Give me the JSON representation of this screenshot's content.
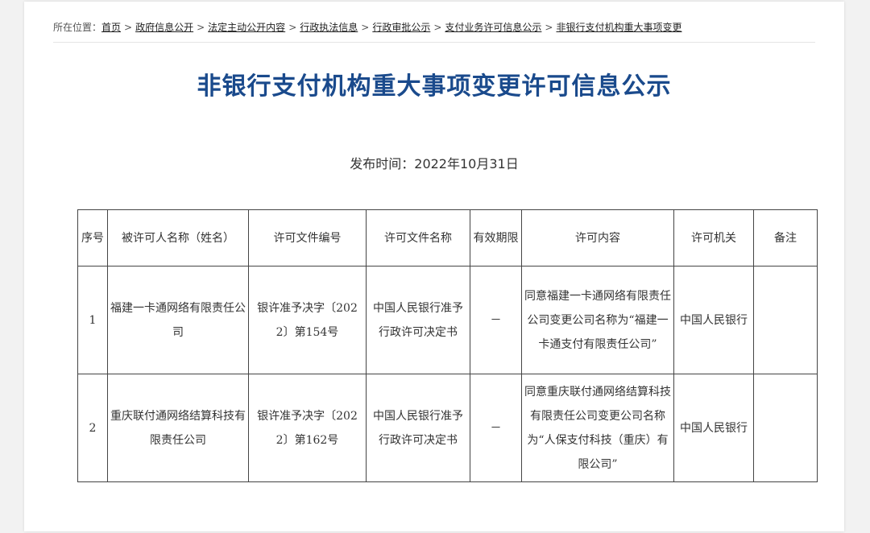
{
  "breadcrumb": {
    "prefix": "所在位置：",
    "items": [
      "首页",
      "政府信息公开",
      "法定主动公开内容",
      "行政执法信息",
      "行政审批公示",
      "支付业务许可信息公示",
      "非银行支付机构重大事项变更"
    ],
    "separator": ">"
  },
  "title": "非银行支付机构重大事项变更许可信息公示",
  "publish_date": "发布时间：2022年10月31日",
  "table": {
    "headers": [
      "序号",
      "被许可人名称（姓名）",
      "许可文件编号",
      "许可文件名称",
      "有效期限",
      "许可内容",
      "许可机关",
      "备注"
    ],
    "rows": [
      [
        "1",
        "福建一卡通网络有限责任公司",
        "银许准予决字〔2022〕第154号",
        "中国人民银行准予行政许可决定书",
        "－",
        "同意福建一卡通网络有限责任公司变更公司名称为“福建一卡通支付有限责任公司”",
        "中国人民银行",
        ""
      ],
      [
        "2",
        "重庆联付通网络结算科技有限责任公司",
        "银许准予决字〔2022〕第162号",
        "中国人民银行准予行政许可决定书",
        "－",
        "同意重庆联付通网络结算科技有限责任公司变更公司名称为“人保支付科技（重庆）有限公司”",
        "中国人民银行",
        ""
      ]
    ]
  },
  "colors": {
    "title": "#1a4a8c",
    "page_background": "#f2f2f2",
    "content_background": "#ffffff"
  }
}
